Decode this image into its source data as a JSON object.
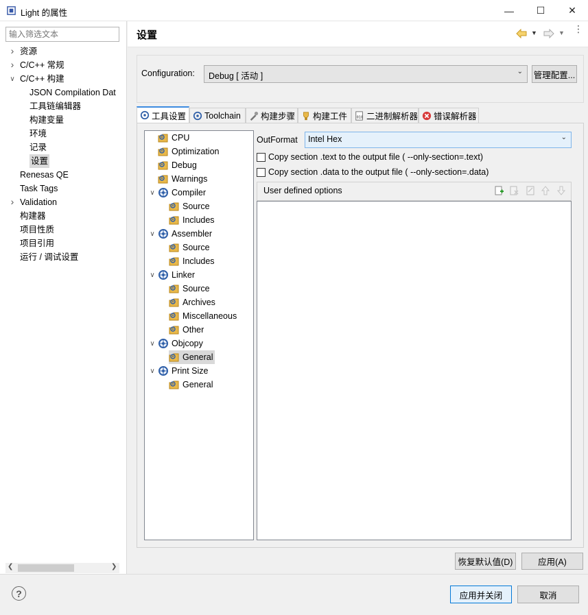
{
  "window": {
    "title": "Light 的属性",
    "minimize_icon": "minimize-icon",
    "maximize_icon": "maximize-icon",
    "close_icon": "close-icon"
  },
  "sidebar": {
    "filter_placeholder": "输入筛选文本",
    "items": [
      {
        "label": "资源",
        "expander": "collapsed"
      },
      {
        "label": "C/C++ 常规",
        "expander": "collapsed"
      },
      {
        "label": "C/C++ 构建",
        "expander": "expanded"
      },
      {
        "label": "JSON Compilation Dat"
      },
      {
        "label": "工具链编辑器"
      },
      {
        "label": "构建变量"
      },
      {
        "label": "环境"
      },
      {
        "label": "记录"
      },
      {
        "label": "设置",
        "selected": true
      },
      {
        "label": "Renesas QE"
      },
      {
        "label": "Task Tags"
      },
      {
        "label": "Validation",
        "expander": "collapsed"
      },
      {
        "label": "构建器"
      },
      {
        "label": "项目性质"
      },
      {
        "label": "项目引用"
      },
      {
        "label": "运行 / 调试设置"
      }
    ]
  },
  "header": {
    "title": "设置",
    "back_icon": "back-arrow-icon",
    "forward_icon": "forward-arrow-icon",
    "menu_icon": "view-menu-icon"
  },
  "config": {
    "label": "Configuration:",
    "value": "Debug  [ 活动 ]",
    "manage_button": "管理配置..."
  },
  "tabs": [
    {
      "label": "工具设置",
      "icon": "tool-settings-icon",
      "active": true
    },
    {
      "label": "Toolchain",
      "icon": "toolchain-icon"
    },
    {
      "label": "构建步骤",
      "icon": "build-steps-icon"
    },
    {
      "label": "构建工件",
      "icon": "build-artifact-icon"
    },
    {
      "label": "二进制解析器",
      "icon": "binary-parser-icon"
    },
    {
      "label": "错误解析器",
      "icon": "error-parser-icon"
    }
  ],
  "tool_tree": [
    {
      "label": "CPU"
    },
    {
      "label": "Optimization"
    },
    {
      "label": "Debug"
    },
    {
      "label": "Warnings"
    },
    {
      "label": "Compiler",
      "expander": "expanded"
    },
    {
      "label": "Source"
    },
    {
      "label": "Includes"
    },
    {
      "label": "Assembler",
      "expander": "expanded"
    },
    {
      "label": "Source"
    },
    {
      "label": "Includes"
    },
    {
      "label": "Linker",
      "expander": "expanded"
    },
    {
      "label": "Source"
    },
    {
      "label": "Archives"
    },
    {
      "label": "Miscellaneous"
    },
    {
      "label": "Other"
    },
    {
      "label": "Objcopy",
      "expander": "expanded"
    },
    {
      "label": "General",
      "selected": true
    },
    {
      "label": "Print Size",
      "expander": "expanded"
    },
    {
      "label": "General"
    }
  ],
  "objcopy": {
    "outformat_label": "OutFormat",
    "outformat_value": "Intel Hex",
    "copy_text_label": "Copy section .text to the output file ( --only-section=.text)",
    "copy_text_checked": false,
    "copy_data_label": "Copy section .data to the output file ( --only-section=.data)",
    "copy_data_checked": false,
    "user_options_label": "User defined options"
  },
  "buttons": {
    "restore_defaults": "恢复默认值(D)",
    "apply": "应用(A)",
    "apply_close": "应用并关闭",
    "cancel": "取消"
  },
  "colors": {
    "accent": "#3c8be0",
    "selected_bg": "#d9d9d9",
    "gear_icon": "#2f5fa8",
    "folder_icon": "#e8b84a",
    "error_icon": "#d83a3a"
  }
}
